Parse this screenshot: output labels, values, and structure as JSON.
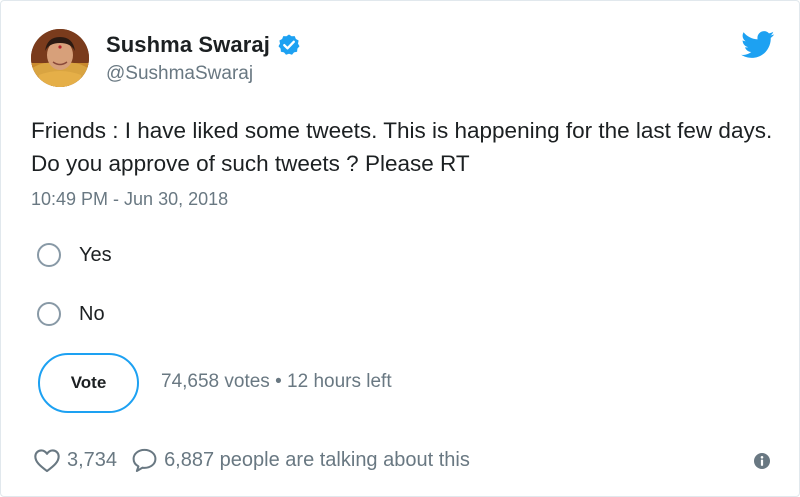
{
  "author": {
    "display_name": "Sushma Swaraj",
    "handle": "@SushmaSwaraj",
    "verified": true
  },
  "tweet": {
    "text": "Friends : I have liked some tweets. This is happening for the last few days. Do you approve of such tweets ? Please RT",
    "timestamp": "10:49 PM - Jun 30, 2018"
  },
  "poll": {
    "options": [
      {
        "label": "Yes"
      },
      {
        "label": "No"
      }
    ],
    "vote_button": "Vote",
    "votes_text": "74,658 votes",
    "separator": " • ",
    "time_left": "12 hours left"
  },
  "actions": {
    "likes": "3,734",
    "replies_text": "6,887 people are talking about this"
  },
  "icons": {
    "brand": "twitter-bird-icon",
    "verified": "verified-badge-icon",
    "like": "heart-icon",
    "reply": "speech-bubble-icon",
    "info": "info-icon"
  },
  "colors": {
    "accent": "#1da1f2",
    "text": "#1c2022",
    "muted": "#697882",
    "radio_border": "#8899a6"
  }
}
